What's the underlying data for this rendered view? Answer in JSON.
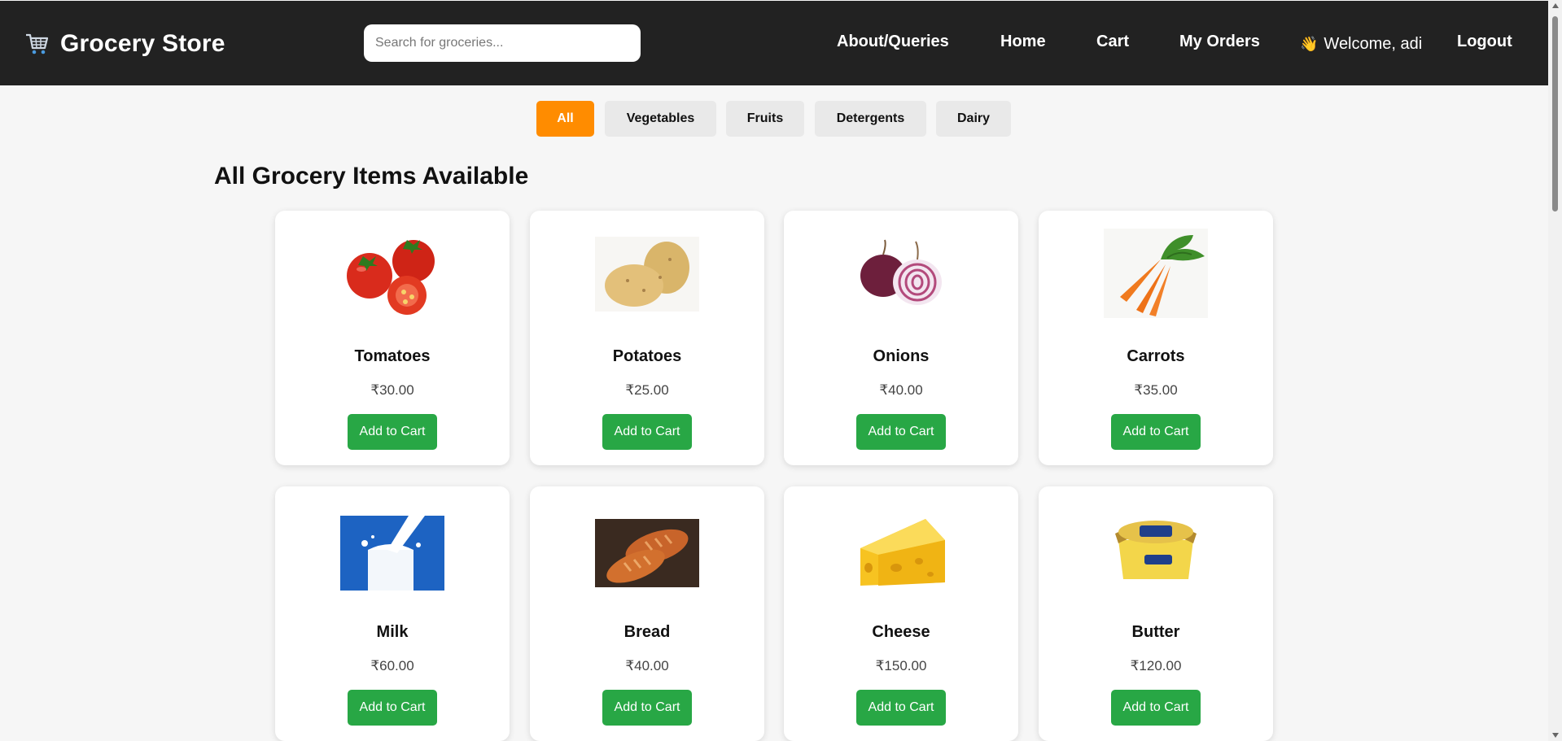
{
  "navbar": {
    "brand_title": "Grocery Store",
    "brand_icon": "shopping-cart-icon",
    "search_placeholder": "Search for groceries...",
    "links": {
      "about": "About/Queries",
      "home": "Home",
      "cart": "Cart",
      "orders": "My Orders",
      "logout": "Logout"
    },
    "welcome_emoji": "👋",
    "welcome_text": "Welcome, adi"
  },
  "filters": [
    {
      "label": "All",
      "active": true
    },
    {
      "label": "Vegetables",
      "active": false
    },
    {
      "label": "Fruits",
      "active": false
    },
    {
      "label": "Detergents",
      "active": false
    },
    {
      "label": "Dairy",
      "active": false
    }
  ],
  "section_title": "All Grocery Items Available",
  "products": [
    {
      "name": "Tomatoes",
      "price": "₹30.00",
      "button": "Add to Cart",
      "image": "tomatoes-image"
    },
    {
      "name": "Potatoes",
      "price": "₹25.00",
      "button": "Add to Cart",
      "image": "potatoes-image"
    },
    {
      "name": "Onions",
      "price": "₹40.00",
      "button": "Add to Cart",
      "image": "onions-image"
    },
    {
      "name": "Carrots",
      "price": "₹35.00",
      "button": "Add to Cart",
      "image": "carrots-image"
    },
    {
      "name": "Milk",
      "price": "₹60.00",
      "button": "Add to Cart",
      "image": "milk-image"
    },
    {
      "name": "Bread",
      "price": "₹40.00",
      "button": "Add to Cart",
      "image": "bread-image"
    },
    {
      "name": "Cheese",
      "price": "₹150.00",
      "button": "Add to Cart",
      "image": "cheese-image"
    },
    {
      "name": "Butter",
      "price": "₹120.00",
      "button": "Add to Cart",
      "image": "butter-image"
    }
  ],
  "colors": {
    "navbar_bg": "#222222",
    "accent_active": "#ff8c00",
    "button_green": "#28a745"
  }
}
